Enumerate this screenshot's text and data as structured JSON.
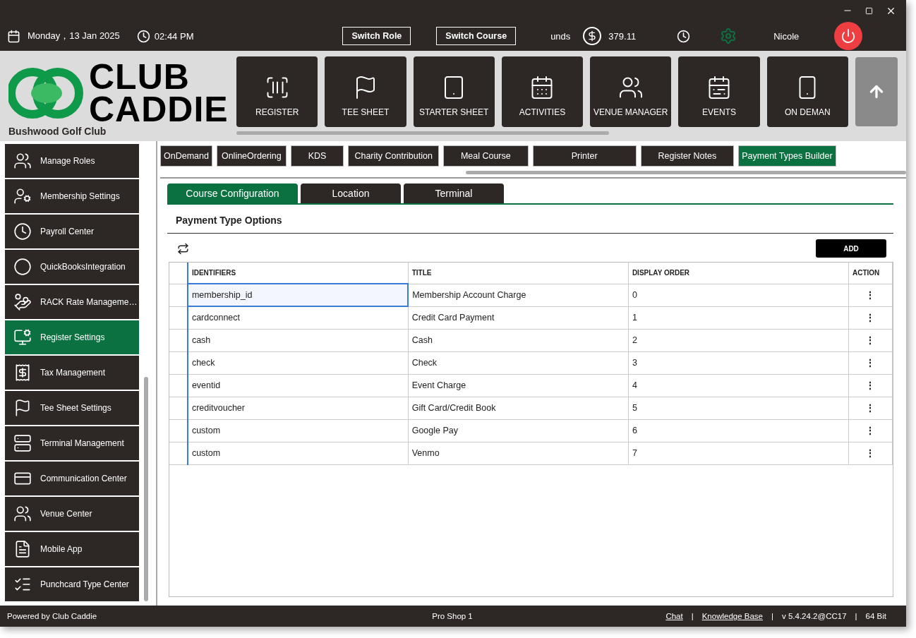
{
  "header": {
    "date": "Monday，13 Jan 2025",
    "time": "02:44 PM",
    "buttons": [
      "Switch Role",
      "Switch Course"
    ],
    "funds_label": "unds",
    "balance": "379.11",
    "user": "Nicole"
  },
  "logo": {
    "lines": [
      "CLUB",
      "CADDIE"
    ],
    "club_name": "Bushwood Golf Club"
  },
  "tiles": [
    {
      "label": "REGISTER"
    },
    {
      "label": "TEE SHEET"
    },
    {
      "label": "STARTER SHEET"
    },
    {
      "label": "ACTIVITIES"
    },
    {
      "label": "VENUE MANAGER"
    },
    {
      "label": "EVENTS"
    },
    {
      "label": "ON DEMAN"
    }
  ],
  "sidebar": {
    "items": [
      {
        "label": "Manage Roles",
        "selected": false
      },
      {
        "label": "Membership Settings",
        "selected": false
      },
      {
        "label": "Payroll Center",
        "selected": false
      },
      {
        "label": "QuickBooksIntegration",
        "selected": false
      },
      {
        "label": "RACK Rate Manageme…",
        "selected": false
      },
      {
        "label": "Register Settings",
        "selected": true
      },
      {
        "label": "Tax Management",
        "selected": false
      },
      {
        "label": "Tee Sheet Settings",
        "selected": false
      },
      {
        "label": "Terminal Management",
        "selected": false
      },
      {
        "label": "Communication Center",
        "selected": false
      },
      {
        "label": "Venue Center",
        "selected": false
      },
      {
        "label": "Mobile App",
        "selected": false
      },
      {
        "label": "Punchcard Type Center",
        "selected": false
      }
    ]
  },
  "settings_tabs": [
    {
      "label": "OnDemand",
      "selected": false
    },
    {
      "label": "OnlineOrdering",
      "selected": false
    },
    {
      "label": "KDS",
      "selected": false
    },
    {
      "label": "Charity Contribution",
      "selected": false
    },
    {
      "label": "Meal Course",
      "selected": false
    },
    {
      "label": "Printer",
      "selected": false
    },
    {
      "label": "Register Notes",
      "selected": false
    },
    {
      "label": "Payment Types Builder",
      "selected": true
    }
  ],
  "config_tabs": [
    {
      "label": "Course Configuration",
      "selected": true
    },
    {
      "label": "Location",
      "selected": false
    },
    {
      "label": "Terminal",
      "selected": false
    }
  ],
  "section_title": "Payment Type Options",
  "add_button": "ADD",
  "table": {
    "columns": [
      "IDENTIFIERS",
      "TITLE",
      "DISPLAY ORDER",
      "ACTION"
    ],
    "rows": [
      {
        "identifier": "membership_id",
        "title": "Membership Account Charge",
        "order": "0",
        "action": "⋮",
        "selected": true
      },
      {
        "identifier": "cardconnect",
        "title": "Credit Card Payment",
        "order": "1",
        "action": "⋮",
        "selected": false
      },
      {
        "identifier": "cash",
        "title": "Cash",
        "order": "2",
        "action": "⋮",
        "selected": false
      },
      {
        "identifier": "check",
        "title": "Check",
        "order": "3",
        "action": "⋮",
        "selected": false
      },
      {
        "identifier": "eventid",
        "title": "Event Charge",
        "order": "4",
        "action": "⋮",
        "selected": false
      },
      {
        "identifier": "creditvoucher",
        "title": "Gift Card/Credit Book",
        "order": "5",
        "action": "⋮",
        "selected": false
      },
      {
        "identifier": "custom",
        "title": "Google Pay",
        "order": "6",
        "action": "⋮",
        "selected": false
      },
      {
        "identifier": "custom",
        "title": "Venmo",
        "order": "7",
        "action": "⋮",
        "selected": false
      }
    ]
  },
  "status_bar": {
    "left": "Powered by Club Caddie",
    "center": "Pro Shop 1",
    "links": [
      "Chat",
      "Knowledge Base"
    ],
    "version": "v 5.4.24.2@CC17",
    "bits": "64 Bit",
    "separator": "|"
  }
}
